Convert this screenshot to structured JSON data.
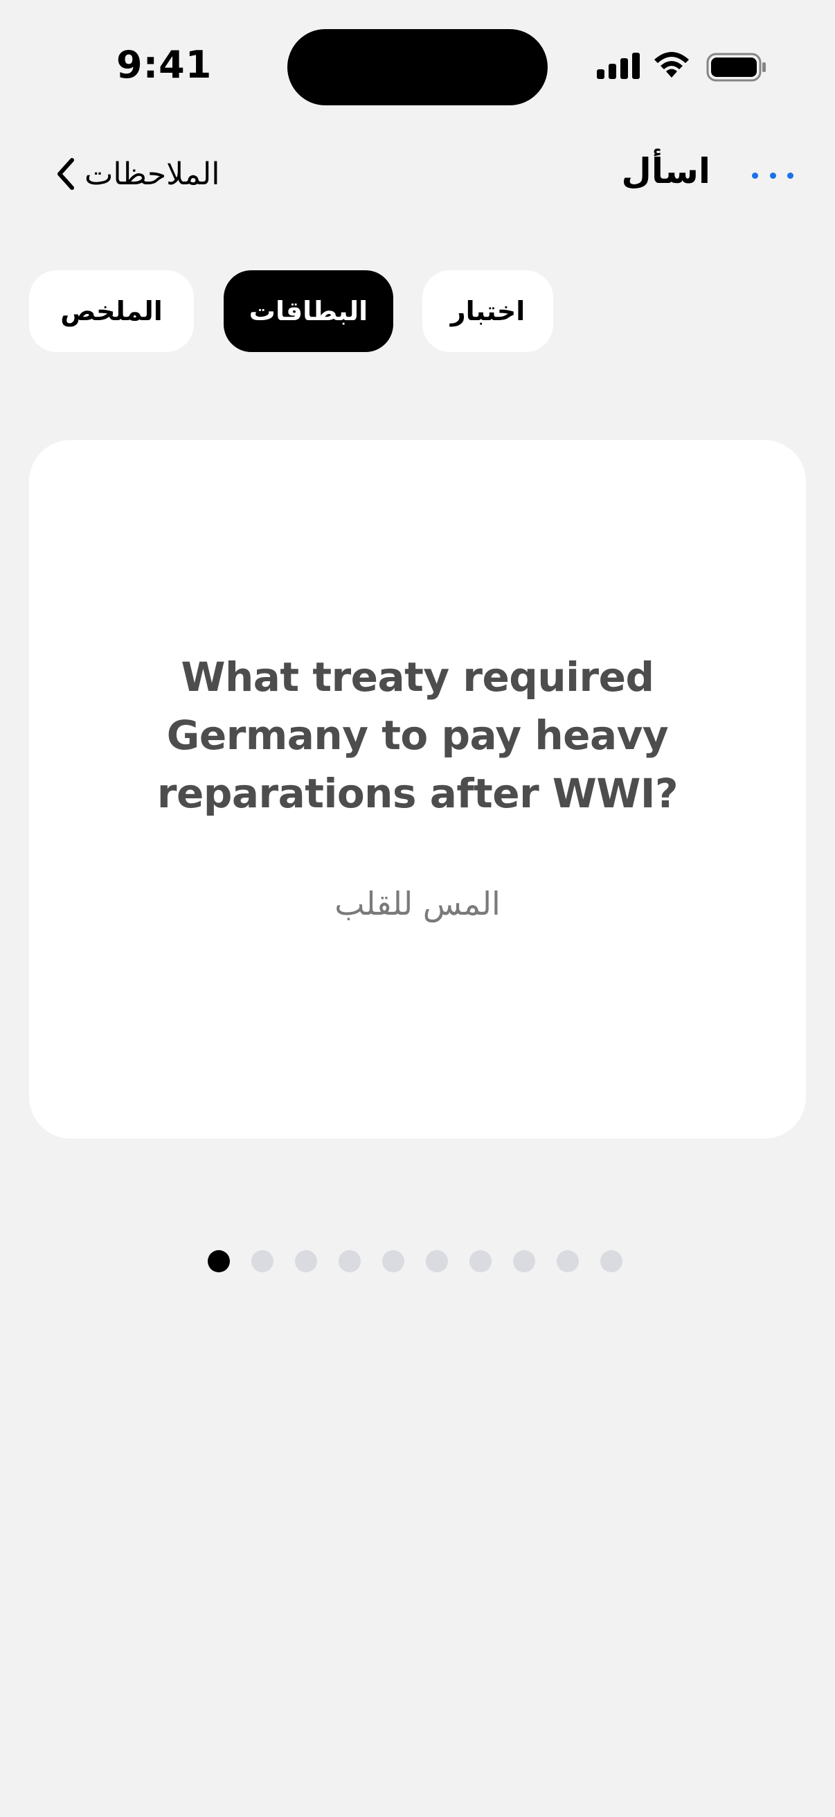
{
  "status_bar": {
    "time": "9:41"
  },
  "nav": {
    "back_label": "الملاحظات",
    "title": "اسأل"
  },
  "tabs": [
    {
      "label": "الملخص",
      "active": false
    },
    {
      "label": "البطاقات",
      "active": true
    },
    {
      "label": "اختبار",
      "active": false
    }
  ],
  "card": {
    "question": "What treaty required Germany to pay heavy reparations after WWI?",
    "hint": "المس للقلب"
  },
  "pager": {
    "total": 10,
    "current": 1
  },
  "colors": {
    "background": "#f2f2f2",
    "accent": "#1a73e8",
    "card": "#ffffff",
    "active_tab": "#000000",
    "inactive_dot": "#d9dbe0"
  }
}
